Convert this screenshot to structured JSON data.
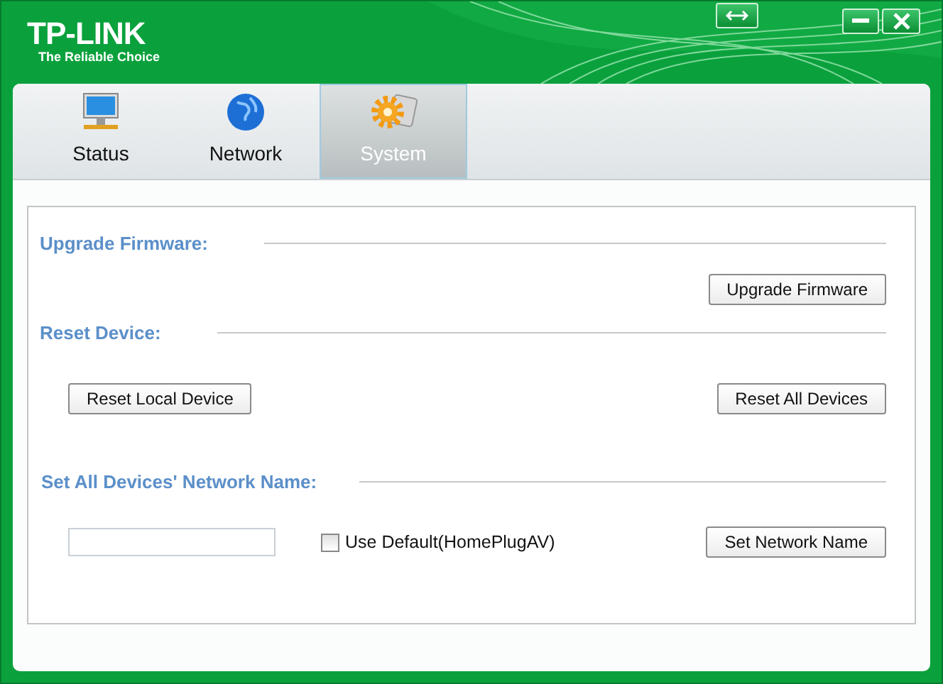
{
  "window": {
    "logo": "TP-LINK",
    "tagline": "The Reliable Choice"
  },
  "tabs": [
    {
      "label": "Status",
      "kind": "monitor",
      "selected": false
    },
    {
      "label": "Network",
      "kind": "globe",
      "selected": false
    },
    {
      "label": "System",
      "kind": "gear",
      "selected": true
    }
  ],
  "upgrade": {
    "heading": "Upgrade Firmware:",
    "button": "Upgrade Firmware"
  },
  "reset": {
    "heading": "Reset Device:",
    "local_button": "Reset Local Device",
    "all_button": "Reset All Devices"
  },
  "network_name": {
    "heading": "Set All Devices' Network Name:",
    "checkbox": {
      "label": "Use Default(HomePlugAV)",
      "checked": false
    },
    "button": "Set Network Name"
  }
}
